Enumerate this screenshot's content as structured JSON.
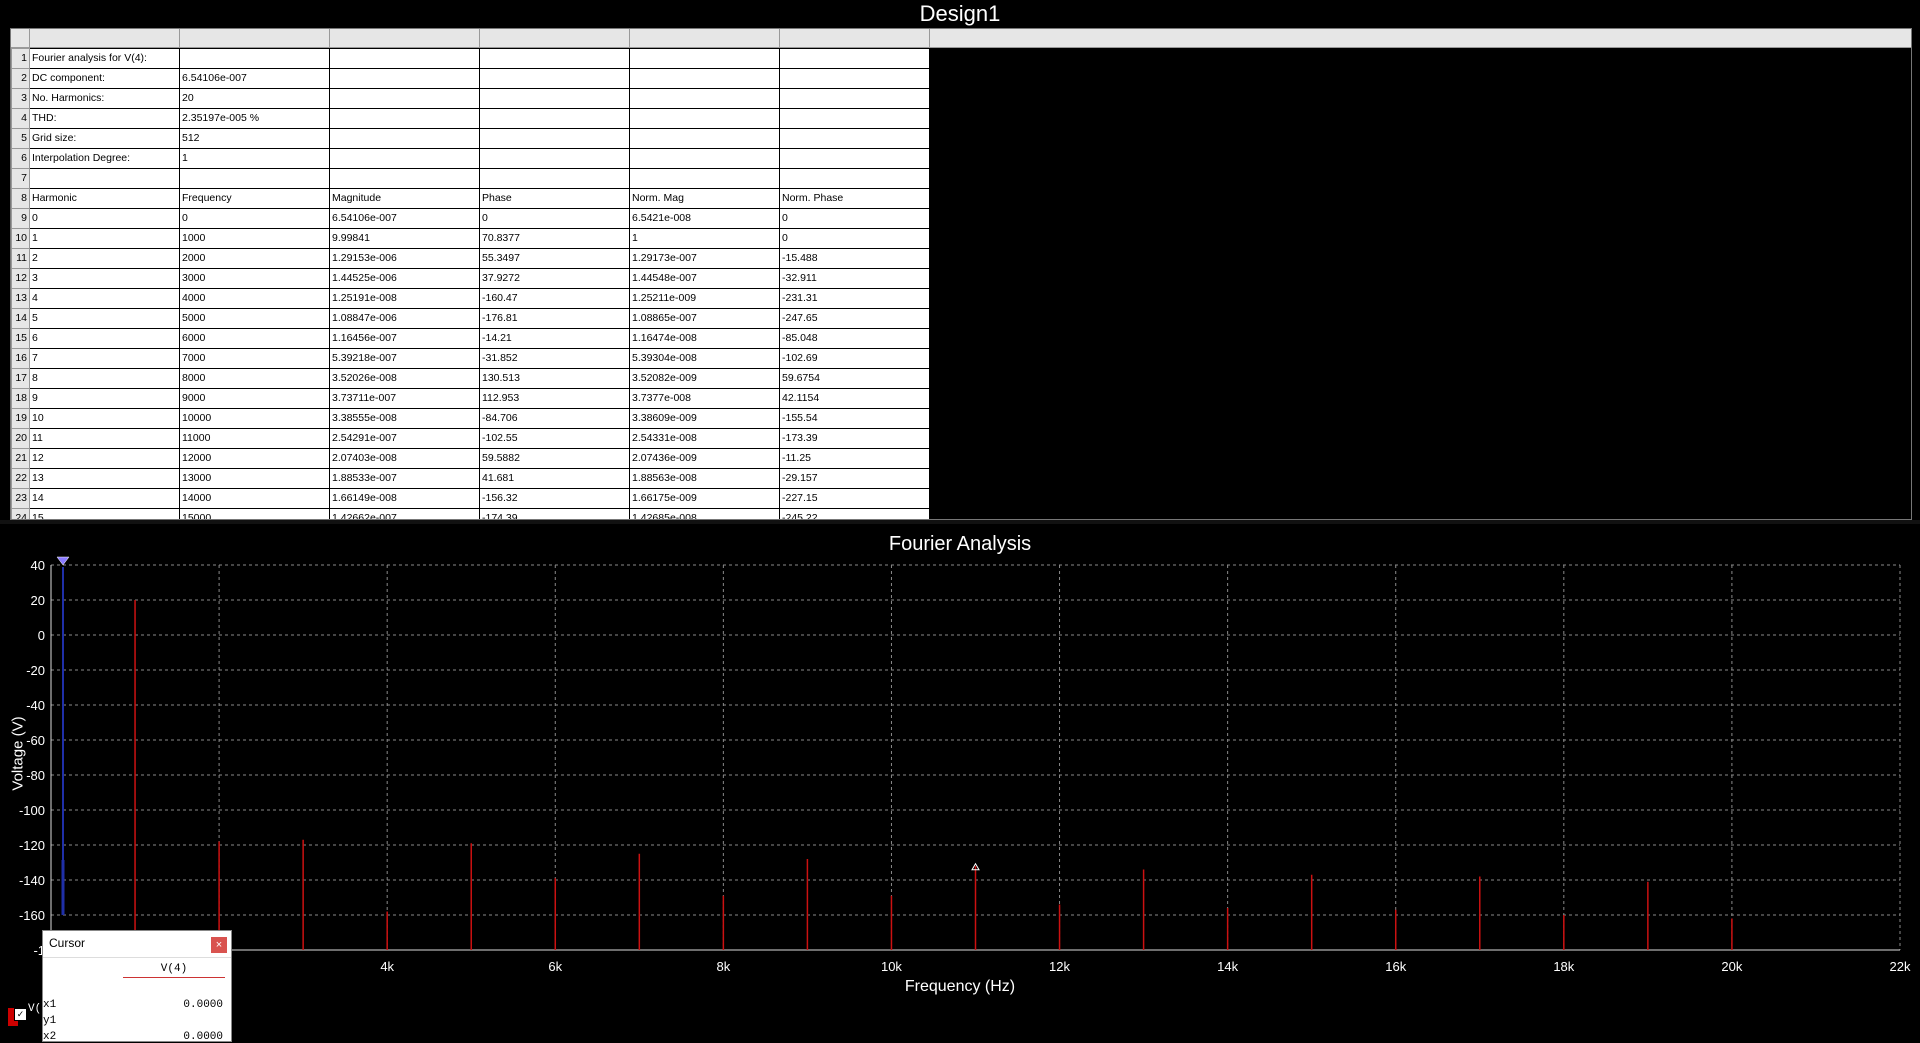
{
  "window": {
    "title": "Design1"
  },
  "sheet": {
    "rows": [
      [
        "1",
        "Fourier analysis for V(4):",
        "",
        "",
        "",
        "",
        ""
      ],
      [
        "2",
        "DC component:",
        "6.54106e-007",
        "",
        "",
        "",
        ""
      ],
      [
        "3",
        "No. Harmonics:",
        "20",
        "",
        "",
        "",
        ""
      ],
      [
        "4",
        "THD:",
        "2.35197e-005 %",
        "",
        "",
        "",
        ""
      ],
      [
        "5",
        "Grid size:",
        "512",
        "",
        "",
        "",
        ""
      ],
      [
        "6",
        "Interpolation Degree:",
        "1",
        "",
        "",
        "",
        ""
      ],
      [
        "7",
        "",
        "",
        "",
        "",
        "",
        ""
      ],
      [
        "8",
        "Harmonic",
        "Frequency",
        "Magnitude",
        "Phase",
        "Norm. Mag",
        "Norm. Phase"
      ],
      [
        "9",
        "0",
        "0",
        "6.54106e-007",
        "0",
        "6.5421e-008",
        "0"
      ],
      [
        "10",
        "1",
        "1000",
        "9.99841",
        "70.8377",
        "1",
        "0"
      ],
      [
        "11",
        "2",
        "2000",
        "1.29153e-006",
        "55.3497",
        "1.29173e-007",
        "-15.488"
      ],
      [
        "12",
        "3",
        "3000",
        "1.44525e-006",
        "37.9272",
        "1.44548e-007",
        "-32.911"
      ],
      [
        "13",
        "4",
        "4000",
        "1.25191e-008",
        "-160.47",
        "1.25211e-009",
        "-231.31"
      ],
      [
        "14",
        "5",
        "5000",
        "1.08847e-006",
        "-176.81",
        "1.08865e-007",
        "-247.65"
      ],
      [
        "15",
        "6",
        "6000",
        "1.16456e-007",
        "-14.21",
        "1.16474e-008",
        "-85.048"
      ],
      [
        "16",
        "7",
        "7000",
        "5.39218e-007",
        "-31.852",
        "5.39304e-008",
        "-102.69"
      ],
      [
        "17",
        "8",
        "8000",
        "3.52026e-008",
        "130.513",
        "3.52082e-009",
        "59.6754"
      ],
      [
        "18",
        "9",
        "9000",
        "3.73711e-007",
        "112.953",
        "3.7377e-008",
        "42.1154"
      ],
      [
        "19",
        "10",
        "10000",
        "3.38555e-008",
        "-84.706",
        "3.38609e-009",
        "-155.54"
      ],
      [
        "20",
        "11",
        "11000",
        "2.54291e-007",
        "-102.55",
        "2.54331e-008",
        "-173.39"
      ],
      [
        "21",
        "12",
        "12000",
        "2.07403e-008",
        "59.5882",
        "2.07436e-009",
        "-11.25"
      ],
      [
        "22",
        "13",
        "13000",
        "1.88533e-007",
        "41.681",
        "1.88563e-008",
        "-29.157"
      ],
      [
        "23",
        "14",
        "14000",
        "1.66149e-008",
        "-156.32",
        "1.66175e-009",
        "-227.15"
      ],
      [
        "24",
        "15",
        "15000",
        "1.42662e-007",
        "-174.39",
        "1.42685e-008",
        "-245.22"
      ]
    ]
  },
  "graph": {
    "title": "Fourier Analysis",
    "ylabel": "Voltage (V)",
    "xlabel": "Frequency (Hz)"
  },
  "chart_data": {
    "type": "bar",
    "title": "Fourier Analysis",
    "xlabel": "Frequency (Hz)",
    "ylabel": "Voltage (V)",
    "xlim": [
      0,
      22000
    ],
    "ylim": [
      -180,
      40
    ],
    "grid": true,
    "x_ticks": [
      2000,
      4000,
      6000,
      8000,
      10000,
      12000,
      14000,
      16000,
      18000,
      20000,
      22000
    ],
    "x_tick_labels": [
      "k",
      "4k",
      "6k",
      "8k",
      "10k",
      "12k",
      "14k",
      "16k",
      "18k",
      "20k",
      "22k"
    ],
    "y_ticks": [
      40,
      20,
      0,
      -20,
      -40,
      -60,
      -80,
      -100,
      -120,
      -140,
      -160,
      -180
    ],
    "y_tick_labels": [
      "40",
      "20",
      "0",
      "-20",
      "-40",
      "-60",
      "-80",
      "-100",
      "-120",
      "-140",
      "-160",
      "-1"
    ],
    "x": [
      1000,
      2000,
      3000,
      4000,
      5000,
      6000,
      7000,
      8000,
      9000,
      10000,
      11000,
      12000,
      13000,
      14000,
      15000,
      16000,
      17000,
      18000,
      19000,
      20000
    ],
    "values": [
      20,
      -118,
      -117,
      -158,
      -119,
      -139,
      -125,
      -149,
      -128,
      -149,
      -132,
      -154,
      -134,
      -156,
      -137,
      -157,
      -138,
      -160,
      -141,
      -162
    ],
    "series_color": "#cc1111",
    "cursor_x": 0,
    "marker_x": 11000,
    "marker_y": -133
  },
  "cursor": {
    "title": "Cursor",
    "close_label": "×",
    "column": "V(4)",
    "rows": [
      {
        "label": "x1",
        "value": "0.0000"
      },
      {
        "label": "y1",
        "value": ""
      },
      {
        "label": "x2",
        "value": "0.0000"
      }
    ]
  },
  "trace": {
    "label": "V("
  }
}
